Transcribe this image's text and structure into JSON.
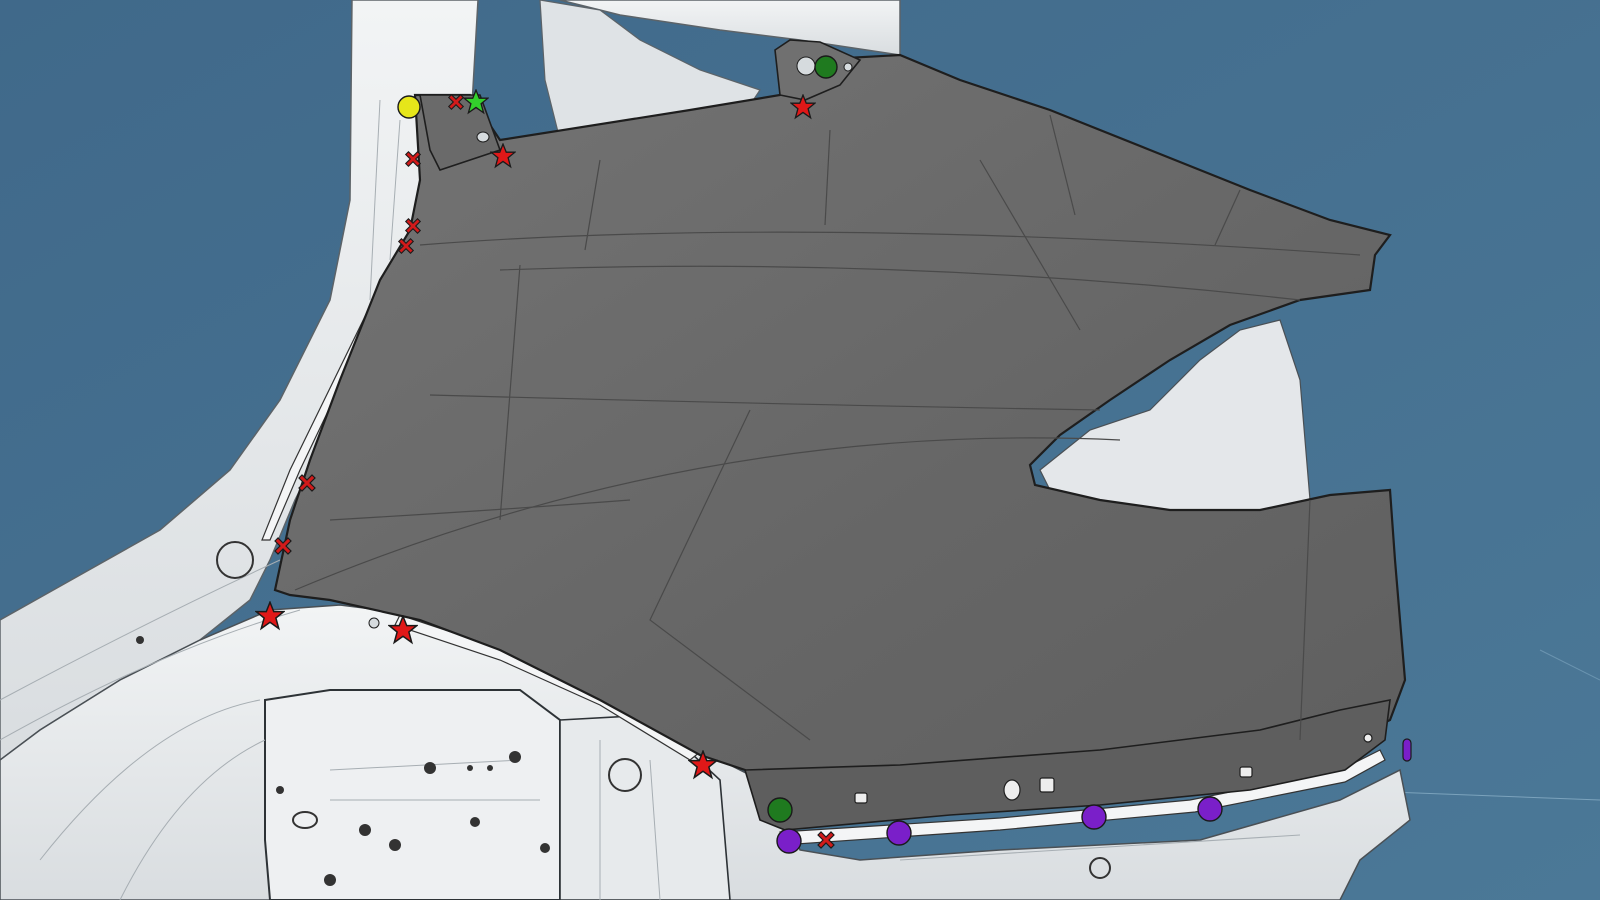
{
  "colors": {
    "background": "#46718f",
    "panel_fill": "#6b6b6b",
    "panel_edge": "#2a2a2a",
    "body_fill": "#e9ecee",
    "body_line": "#9aa1a6",
    "star_red": "#e01818",
    "cross_red": "#d11a1a",
    "star_green": "#33d12c",
    "dot_yellow": "#e6e61a",
    "dot_green": "#1f7a1f",
    "dot_purple": "#7a1fc9"
  },
  "icons": {
    "weld_star": "star-icon",
    "weld_cross": "cross-icon",
    "weld_dot": "circle-icon"
  }
}
